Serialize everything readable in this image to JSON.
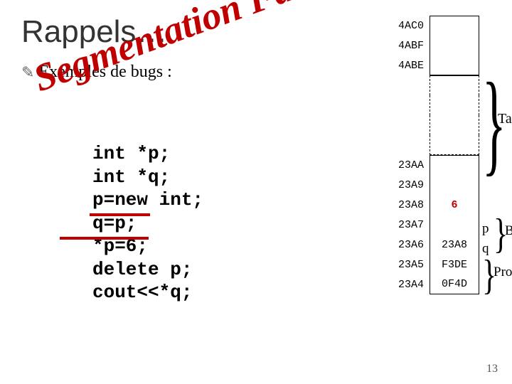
{
  "title": "Rappels…",
  "subtitle": "Exemples de bugs :",
  "overlay": "Segmentation Fault !!!",
  "code": [
    "int *p;",
    "int *q;",
    "p=new int;",
    "q=p;",
    "*p=6;",
    "delete p;",
    "cout<<*q;"
  ],
  "memory": {
    "topAddrs": [
      "4AC0",
      "4ABF",
      "4ABE"
    ],
    "dashCount": 4,
    "rows": [
      {
        "addr": "23AA",
        "val": ""
      },
      {
        "addr": "23A9",
        "val": ""
      },
      {
        "addr": "23A8",
        "val": "6"
      },
      {
        "addr": "23A7",
        "val": ""
      },
      {
        "addr": "23A6",
        "val": "23A8"
      },
      {
        "addr": "23A5",
        "val": "F3DE"
      },
      {
        "addr": "23A4",
        "val": "0F4D"
      }
    ],
    "valueClasses": [
      "",
      "",
      "red",
      "",
      "",
      "",
      ""
    ]
  },
  "labels": {
    "tas": "Tas",
    "p": "p",
    "q": "q",
    "bss": "BSS",
    "prog": "Prog"
  },
  "slideNum": "13"
}
